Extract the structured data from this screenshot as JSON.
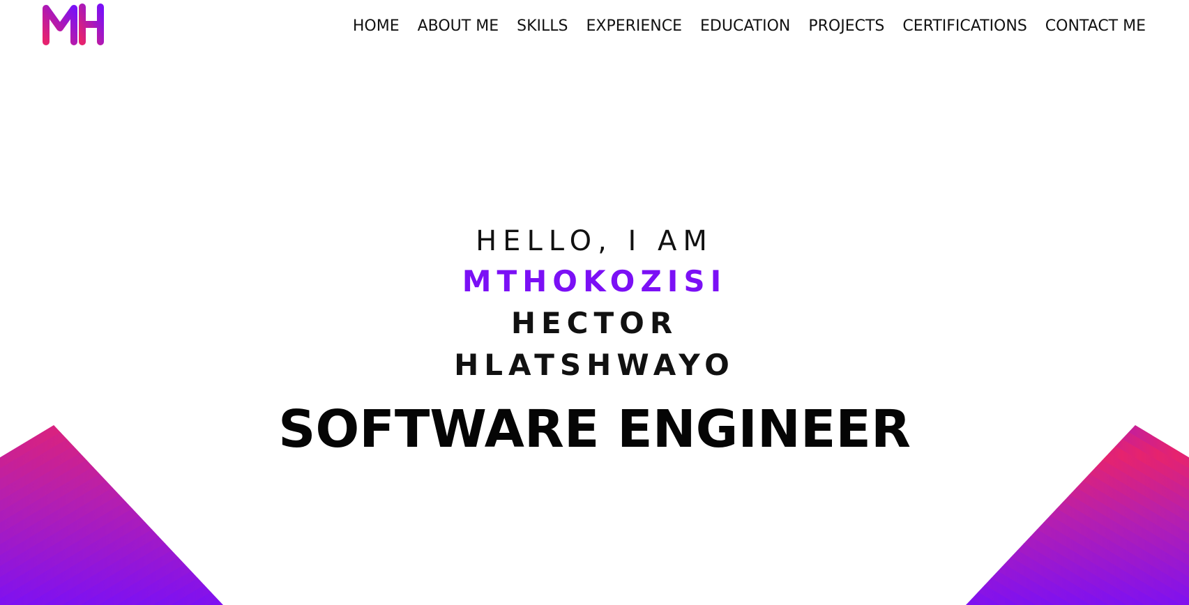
{
  "logo": {
    "text": "MH",
    "gradient_start": "#e6236e",
    "gradient_end": "#7b10f5"
  },
  "nav": {
    "items": [
      {
        "label": "HOME"
      },
      {
        "label": "ABOUT ME"
      },
      {
        "label": "SKILLS"
      },
      {
        "label": "EXPERIENCE"
      },
      {
        "label": "EDUCATION"
      },
      {
        "label": "PROJECTS"
      },
      {
        "label": "CERTIFICATIONS"
      },
      {
        "label": "CONTACT ME"
      }
    ]
  },
  "hero": {
    "greeting": "HELLO, I AM",
    "first_name": "MTHOKOZISI",
    "last_names": "HECTOR HLATSHWAYO",
    "role": "SOFTWARE ENGINEER",
    "accent_color": "#7b10f5"
  },
  "decorations": {
    "stripe_colors": [
      "#7b10f5",
      "#e6236e"
    ],
    "icon": "diagonal-stripes"
  }
}
